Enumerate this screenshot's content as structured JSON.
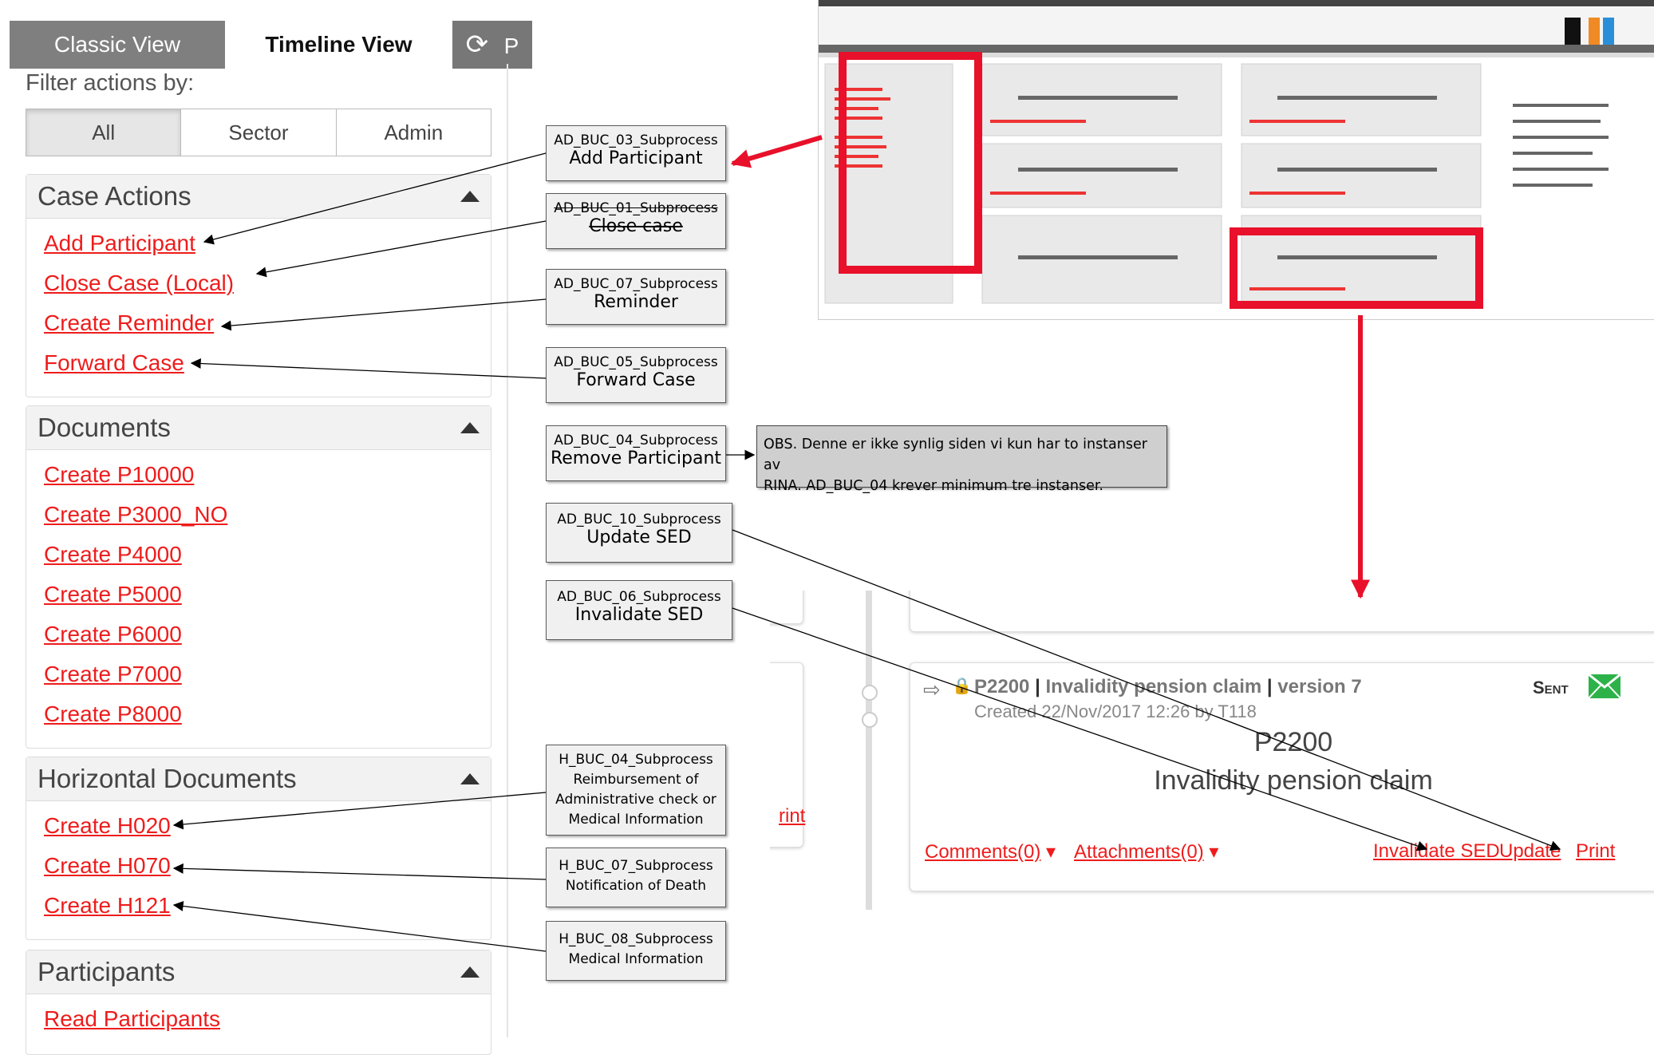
{
  "tabs": {
    "classic": "Classic View",
    "timeline": "Timeline View",
    "refresh_partial": "P"
  },
  "filter": {
    "label": "Filter actions by:",
    "options": [
      "All",
      "Sector",
      "Admin"
    ]
  },
  "sections": {
    "case_actions": {
      "title": "Case Actions",
      "links": [
        "Add Participant",
        "Close Case (Local)",
        "Create Reminder",
        "Forward Case"
      ]
    },
    "documents": {
      "title": "Documents",
      "links": [
        "Create P10000",
        "Create P3000_NO",
        "Create P4000",
        "Create P5000",
        "Create P6000",
        "Create P7000",
        "Create P8000"
      ]
    },
    "horizontal": {
      "title": "Horizontal Documents",
      "links": [
        "Create H020",
        "Create H070",
        "Create H121"
      ]
    },
    "participants": {
      "title": "Participants",
      "links": [
        "Read Participants"
      ]
    }
  },
  "labels": {
    "add_participant": {
      "code": "AD_BUC_03_Subprocess",
      "name": "Add Participant"
    },
    "close_case": {
      "code": "AD_BUC_01_Subprocess",
      "name": "Close case"
    },
    "reminder": {
      "code": "AD_BUC_07_Subprocess",
      "name": "Reminder"
    },
    "forward_case": {
      "code": "AD_BUC_05_Subprocess",
      "name": "Forward Case"
    },
    "remove_participant": {
      "code": "AD_BUC_04_Subprocess",
      "name": "Remove Participant"
    },
    "update_sed": {
      "code": "AD_BUC_10_Subprocess",
      "name": "Update SED"
    },
    "invalidate_sed": {
      "code": "AD_BUC_06_Subprocess",
      "name": "Invalidate SED"
    },
    "h020": {
      "code": "H_BUC_04_Subprocess",
      "lines": [
        "Reimbursement of",
        "Administrative check or",
        "Medical Information"
      ]
    },
    "h070": {
      "code": "H_BUC_07_Subprocess",
      "lines": [
        "Notification of Death"
      ]
    },
    "h121": {
      "code": "H_BUC_08_Subprocess",
      "lines": [
        "Medical Information"
      ]
    }
  },
  "note": {
    "line1": "OBS. Denne er ikke synlig siden vi kun har to instanser av",
    "line2": "RINA. AD_BUC_04 krever minimum tre instanser."
  },
  "card": {
    "doc_code": "P2200",
    "doc_title": "Invalidity pension claim",
    "version": "version 7",
    "created": "Created 22/Nov/2017 12:26 by T118",
    "status": "Sent",
    "center_code": "P2200",
    "center_title": "Invalidity pension claim",
    "comments": "Comments(0)",
    "attachments": "Attachments(0)",
    "invalidate": "Invalidate SED",
    "update": "Update",
    "print": "Print",
    "left_print_partial": "rint"
  },
  "colors": {
    "link": "#ee1c1c",
    "highlight": "#e8102a",
    "sent_green": "#2db24a"
  },
  "icons": {
    "refresh": "refresh-icon",
    "collapse": "triangle-up-icon",
    "envelope": "envelope-icon",
    "forward": "forward-icon",
    "lock": "lock-icon"
  }
}
